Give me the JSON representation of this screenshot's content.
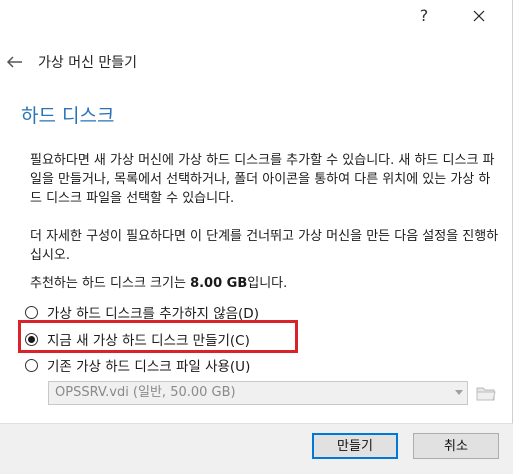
{
  "titlebar": {
    "help_label": "?"
  },
  "header": {
    "wizard_title": "가상 머신 만들기"
  },
  "page": {
    "title": "하드 디스크",
    "paragraph1": "필요하다면 새 가상 머신에 가상 하드 디스크를 추가할 수 있습니다. 새 하드 디스크 파일을 만들거나, 목록에서 선택하거나, 폴더 아이콘을 통하여 다른 위치에 있는 가상 하드 디스크 파일을 선택할 수 있습니다.",
    "paragraph2": "더 자세한 구성이 필요하다면 이 단계를 건너뛰고 가상 머신을 만든 다음 설정을 진행하십시오.",
    "recommend_prefix": "추천하는 하드 디스크 크기는 ",
    "recommend_size": "8.00 GB",
    "recommend_suffix": "입니다."
  },
  "options": [
    {
      "label": "가상 하드 디스크를 추가하지 않음(D)",
      "checked": false
    },
    {
      "label": "지금 새 가상 하드 디스크 만들기(C)",
      "checked": true
    },
    {
      "label": "기존 가상 하드 디스크 파일 사용(U)",
      "checked": false
    }
  ],
  "existing_file": {
    "value": "OPSSRV.vdi (일반, 50.00 GB)",
    "enabled": false
  },
  "buttons": {
    "create": "만들기",
    "cancel": "취소"
  },
  "colors": {
    "title_blue": "#2a73b8",
    "highlight_red": "#d8232a",
    "primary_border": "#0078d7"
  }
}
